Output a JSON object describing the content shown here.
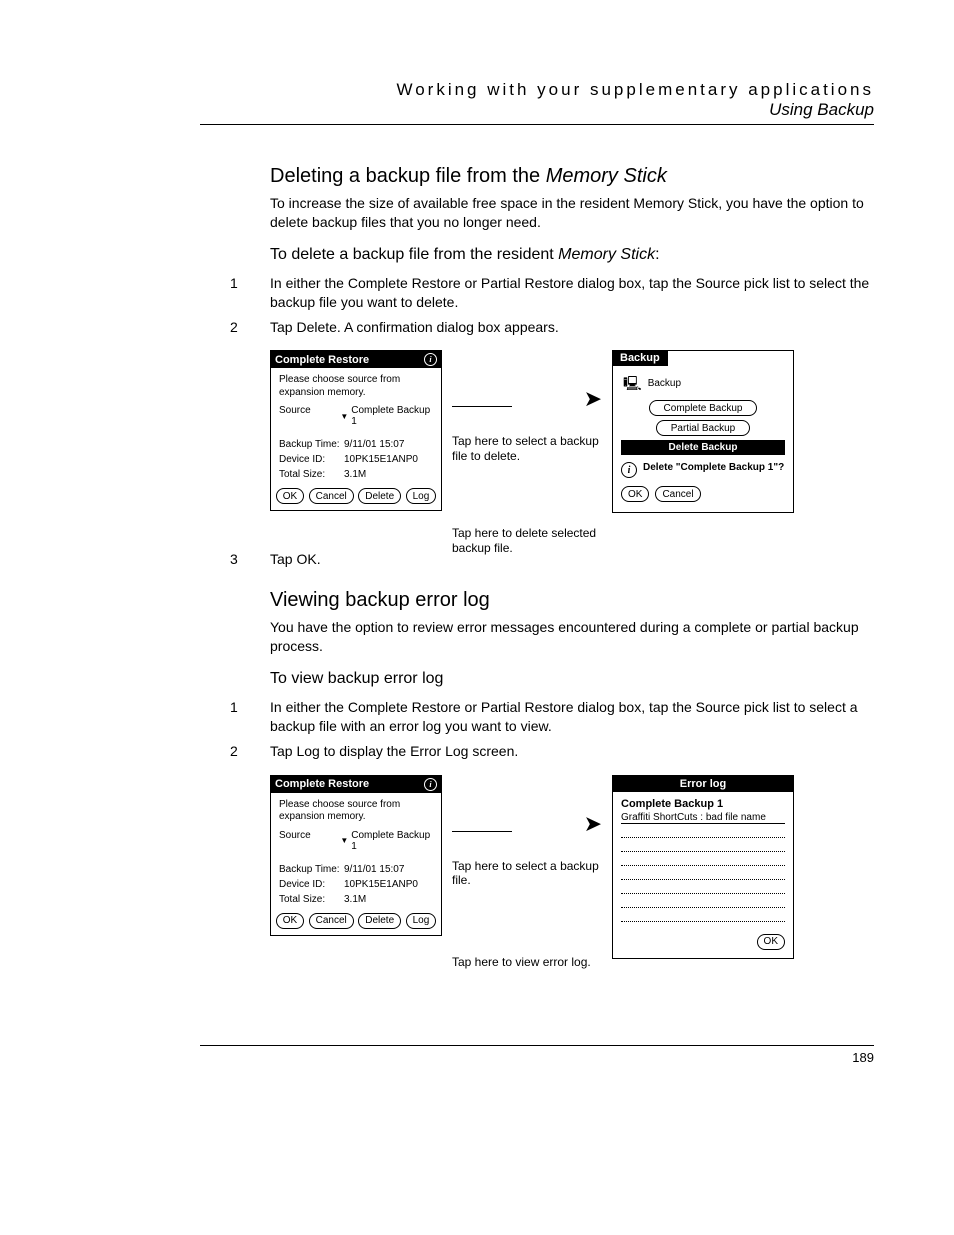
{
  "header": {
    "line1": "Working with your supplementary applications",
    "line2": "Using Backup"
  },
  "sectionA": {
    "title_plain": "Deleting a backup file from the ",
    "title_italic": "Memory Stick",
    "intro": "To increase the size of available free space in the resident Memory Stick, you have the option to delete backup files that you no longer need.",
    "sub_plain": "To delete a backup file from the resident ",
    "sub_italic": "Memory Stick",
    "sub_suffix": ":",
    "step1": "In either the Complete Restore or Partial Restore dialog box, tap the Source pick list to select the backup file you want to delete.",
    "step2": "Tap Delete. A confirmation dialog box appears.",
    "step3": "Tap OK."
  },
  "palm_restore": {
    "title": "Complete Restore",
    "msg": "Please choose source from expansion memory.",
    "source_lbl": "Source",
    "source_val": "Complete Backup 1",
    "rows": {
      "time_lbl": "Backup Time:",
      "time_val": "9/11/01 15:07",
      "dev_lbl": "Device ID:",
      "dev_val": "10PK15E1ANP0",
      "size_lbl": "Total Size:",
      "size_val": "3.1M"
    },
    "buttons": {
      "ok": "OK",
      "cancel": "Cancel",
      "delete": "Delete",
      "log": "Log"
    }
  },
  "calloutsA": {
    "c1": "Tap here to select a backup file to delete.",
    "c2": "Tap here to delete selected backup file."
  },
  "palm_backup": {
    "tab": "Backup",
    "heading": "Backup",
    "btn_cb": "Complete Backup",
    "btn_pb": "Partial Backup",
    "btn_db": "Delete Backup",
    "confirm": "Delete \"Complete Backup 1\"?",
    "ok": "OK",
    "cancel": "Cancel"
  },
  "sectionB": {
    "title": "Viewing backup error log",
    "intro": "You have the option to review error messages encountered during a complete or partial backup process.",
    "sub": "To view backup error log",
    "step1": "In either the Complete Restore or Partial Restore dialog box, tap the Source pick list to select a backup file with an error log you want to view.",
    "step2": "Tap Log to display the Error Log screen."
  },
  "calloutsB": {
    "c1": "Tap here to select a backup file.",
    "c2": "Tap here to view error log."
  },
  "palm_errlog": {
    "title": "Error log",
    "heading": "Complete Backup 1",
    "entry": "Graffiti ShortCuts : bad file name",
    "ok": "OK"
  },
  "page_number": "189"
}
